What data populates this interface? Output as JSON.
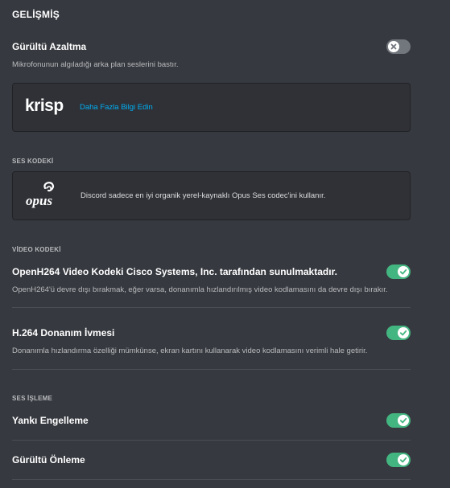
{
  "title": "GELİŞMİŞ",
  "noise_reduction": {
    "title": "Gürültü Azaltma",
    "description": "Mikrofonunun algıladığı arka plan seslerini bastır.",
    "enabled": false
  },
  "krisp": {
    "logo_text": "krisp",
    "link_text": "Daha Fazla Bilgi Edin"
  },
  "audio_codec": {
    "header": "SES KODEKİ",
    "logo_text": "opus",
    "description": "Discord sadece en iyi organik yerel-kaynaklı Opus Ses codec'ini kullanır."
  },
  "video_codec": {
    "header": "VİDEO KODEKİ",
    "openh264": {
      "title": "OpenH264 Video Kodeki Cisco Systems, Inc. tarafından sunulmaktadır.",
      "description": "OpenH264'ü devre dışı bırakmak, eğer varsa, donanımla hızlandırılmış video kodlamasını da devre dışı bırakır.",
      "enabled": true
    },
    "h264_hw": {
      "title": "H.264 Donanım İvmesi",
      "description": "Donanımla hızlandırma özelliği mümkünse, ekran kartını kullanarak video kodlamasını verimli hale getirir.",
      "enabled": true
    }
  },
  "audio_processing": {
    "header": "SES İŞLEME",
    "echo_cancellation": {
      "title": "Yankı Engelleme",
      "enabled": true
    },
    "noise_suppression": {
      "title": "Gürültü Önleme",
      "enabled": true
    }
  },
  "colors": {
    "background": "#36393f",
    "card": "#2f3136",
    "toggle_on": "#43b581",
    "toggle_off": "#72767d",
    "link": "#00aff4"
  }
}
